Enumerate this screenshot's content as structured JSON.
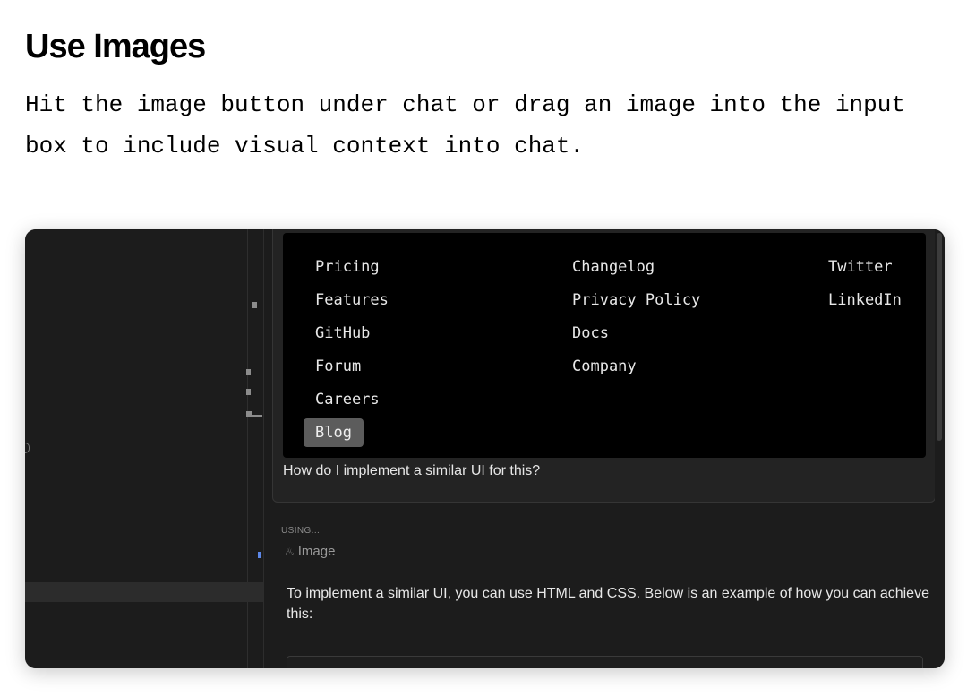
{
  "section": {
    "title": "Use Images",
    "description": "Hit the image button under chat or drag an image into the input box to include visual context into chat."
  },
  "screenshot": {
    "footer_columns": [
      [
        "Pricing",
        "Features",
        "GitHub",
        "Forum",
        "Careers",
        "Blog"
      ],
      [
        "Changelog",
        "Privacy Policy",
        "Docs",
        "Company"
      ],
      [
        "Twitter",
        "LinkedIn"
      ]
    ],
    "active_link": "Blog",
    "question": "How do I implement a similar UI for this?",
    "using_label": "USING...",
    "context_item": {
      "icon": "image-icon",
      "label": "Image"
    },
    "answer": "To implement a similar UI, you can use HTML and CSS. Below is an example of how you can achieve this:",
    "colors": {
      "panel_bg": "#1c1c1c",
      "card_bg": "#232323",
      "footer_bg": "#000000",
      "active_bg": "#5c5c5c"
    }
  }
}
